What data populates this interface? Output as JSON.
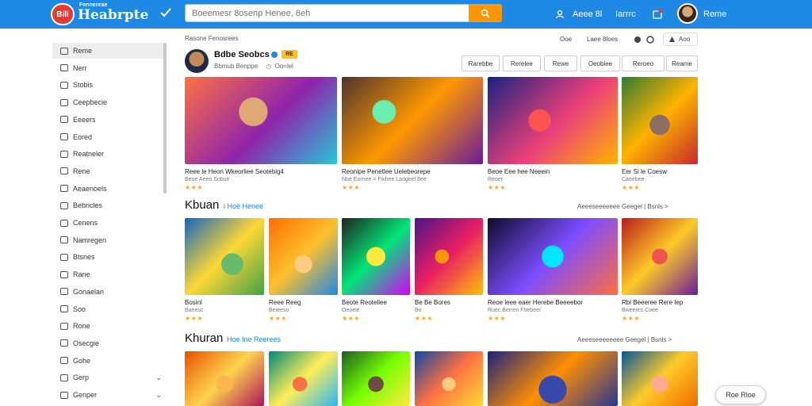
{
  "colors": {
    "topbar": "#1e88e5",
    "accent_orange": "#ff9800",
    "star": "#f9a825",
    "link_blue": "#1e88e5"
  },
  "header": {
    "logo_badge": "Bili",
    "logo_sup": "Fennenrae",
    "logo_text": "Heabrpte",
    "search_placeholder": "Boeemesr 8osenp Henee, 8eh",
    "right_links": [
      "Aeee 8l",
      "Iarrrc",
      "Reme"
    ]
  },
  "sidebar": {
    "items": [
      {
        "label": "Reme",
        "icon": "home-icon",
        "active": true
      },
      {
        "label": "Nerr",
        "icon": "new-icon"
      },
      {
        "label": "Stobis",
        "icon": "grid-icon"
      },
      {
        "label": "Ceepbecie",
        "icon": "category-icon"
      },
      {
        "label": "Eeeers",
        "icon": "list-icon"
      },
      {
        "label": "Eored",
        "icon": "bookmark-icon"
      },
      {
        "label": "Reatneler",
        "icon": "star-icon"
      },
      {
        "label": "Rene",
        "icon": "trending-icon"
      },
      {
        "label": "Aeaenoels",
        "icon": "mail-icon"
      },
      {
        "label": "Bebricles",
        "icon": "edit-icon"
      },
      {
        "label": "Cenens",
        "icon": "box-icon"
      },
      {
        "label": "Namregen",
        "icon": "chart-icon"
      },
      {
        "label": "Btsnes",
        "icon": "calendar-icon"
      },
      {
        "label": "Rane",
        "icon": "doc-icon"
      },
      {
        "label": "Gonaelan",
        "icon": "shield-icon"
      },
      {
        "label": "Soo",
        "icon": "link-icon"
      },
      {
        "label": "Rone",
        "icon": "folder-icon"
      },
      {
        "label": "Osecgie",
        "icon": "settings-icon"
      },
      {
        "label": "Gohe",
        "icon": "user-icon"
      },
      {
        "label": "Gerp",
        "icon": "history-icon",
        "chevron": true
      },
      {
        "label": "Genper",
        "icon": "help-icon",
        "chevron": true
      }
    ]
  },
  "breadcrumb": "Rasone Fenosrees",
  "top_right_chips": [
    "Ooe",
    "Laee 8loes",
    "Aoo"
  ],
  "channel": {
    "name": "Bdbe Seobcs",
    "badge": "RE",
    "sub": "Bbmub  Benppe",
    "sub2": "Oo=lel"
  },
  "filter_chips": [
    "Rarebbe",
    "Rerelee",
    "Rewe",
    "Oeobiee",
    "Reroeo",
    "Reame"
  ],
  "sections": [
    {
      "cards": [
        {
          "title": "Reee le Heon Wkeorliee Seotebig4",
          "sub": "Beoe  Aeeo   Sobue",
          "stars": "★★★"
        },
        {
          "title": "Reonipe Penetlee Uelebeorepe",
          "sub": "Nbe Eornee = Fwhee Ladgeel 8ee",
          "stars": "★★★"
        },
        {
          "title": "Beoe Eee hee Neeein",
          "sub": "Reoer",
          "stars": "★★★"
        },
        {
          "title": "Eer Si le Coesw",
          "sub": "Caeebee",
          "stars": "★★★"
        }
      ]
    },
    {
      "title": "Kbuan",
      "subtitle": "i Hoe Henee",
      "link": "Aeeeseeeeeee Geegel   | Bsnls  >",
      "cards": [
        {
          "title": "Bosinl",
          "sub": "Baeesc",
          "stars": "★★★"
        },
        {
          "title": "Reee Reeg",
          "sub": "Beieeso",
          "stars": "★★★"
        },
        {
          "title": "Beote Reoteliee",
          "sub": "Oeoeie",
          "stars": "★★★"
        },
        {
          "title": "Be Be Bores",
          "sub": "Bo",
          "stars": "★★★"
        },
        {
          "title": "Reoe leee eaer Herebe Beeeebor",
          "sub": "Ruec Berren  Fhebee/",
          "stars": "★★★"
        },
        {
          "title": "Rbl Beeeree Rere Iep",
          "sub": "Bweeres  Coee",
          "stars": "★★★"
        }
      ]
    },
    {
      "title": "Khuran",
      "subtitle": "Hoe Ine Reerees",
      "link": "Aeeeseeeeeeee Geegel   | Bsnls  >",
      "cards": [
        {
          "title": "",
          "sub": "",
          "stars": ""
        },
        {
          "title": "",
          "sub": "",
          "stars": ""
        },
        {
          "title": "",
          "sub": "",
          "stars": ""
        },
        {
          "title": "",
          "sub": "",
          "stars": ""
        },
        {
          "title": "",
          "sub": "",
          "stars": ""
        },
        {
          "title": "",
          "sub": "",
          "stars": ""
        }
      ]
    }
  ],
  "fab_label": "Roe Rloe"
}
